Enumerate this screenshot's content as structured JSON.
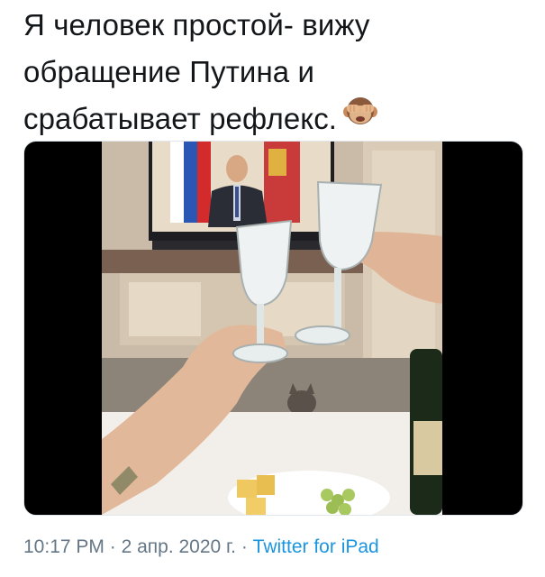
{
  "tweet": {
    "text_lines": [
      "Я человек простой- вижу",
      "обращение Путина и",
      "срабатывает рефлекс."
    ],
    "emoji_icon": "see-no-evil-monkey-icon"
  },
  "media": {
    "type": "photo",
    "icon": "photo-icon"
  },
  "meta": {
    "time": "10:17 PM",
    "separator": "·",
    "date": "2 апр. 2020 г.",
    "source": "Twitter for iPad"
  },
  "colors": {
    "text": "#14171a",
    "meta": "#657786",
    "link": "#1b95e0",
    "media_bg": "#000000"
  }
}
